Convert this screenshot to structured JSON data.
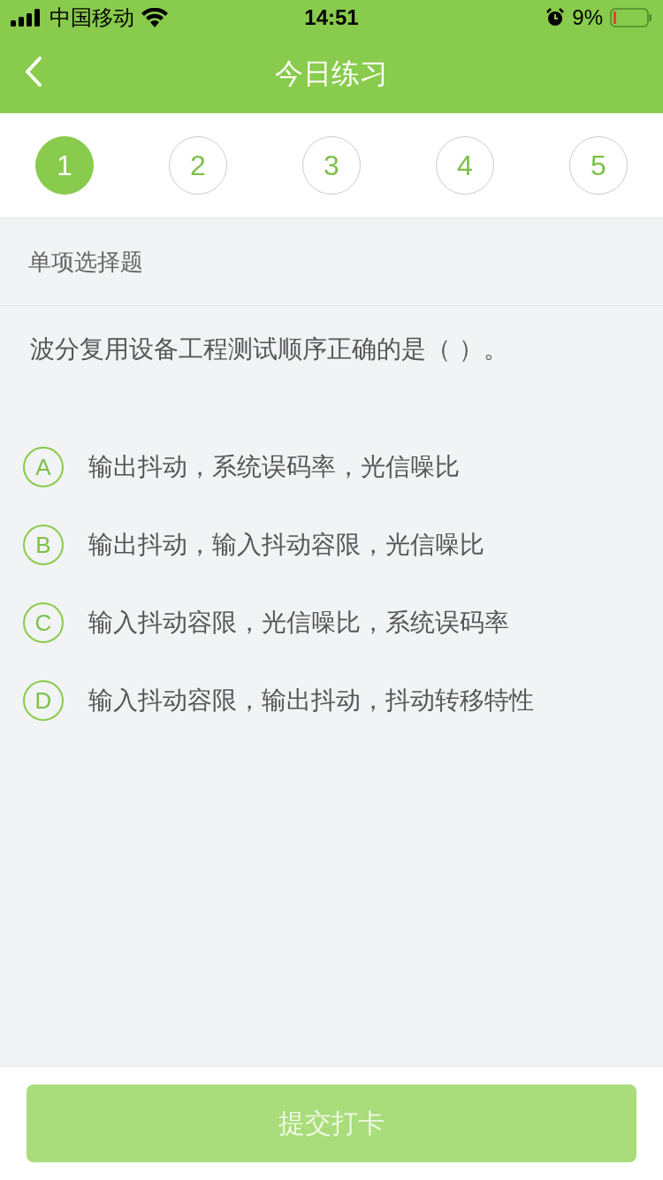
{
  "status_bar": {
    "carrier": "中国移动",
    "time": "14:51",
    "battery": "9%"
  },
  "nav": {
    "title": "今日练习"
  },
  "steps": [
    {
      "label": "1",
      "selected": true
    },
    {
      "label": "2",
      "selected": false
    },
    {
      "label": "3",
      "selected": false
    },
    {
      "label": "4",
      "selected": false
    },
    {
      "label": "5",
      "selected": false
    }
  ],
  "section": "单项选择题",
  "question": "波分复用设备工程测试顺序正确的是（   ）。",
  "options": [
    {
      "letter": "A",
      "text": "输出抖动，系统误码率，光信噪比",
      "selected": false
    },
    {
      "letter": "B",
      "text": "输出抖动，输入抖动容限，光信噪比",
      "selected": false
    },
    {
      "letter": "C",
      "text": "输入抖动容限，光信噪比，系统误码率",
      "selected": false
    },
    {
      "letter": "D",
      "text": "输入抖动容限，输出抖动，抖动转移特性",
      "selected": false
    }
  ],
  "submit": {
    "label": "提交打卡",
    "disabled": true
  }
}
